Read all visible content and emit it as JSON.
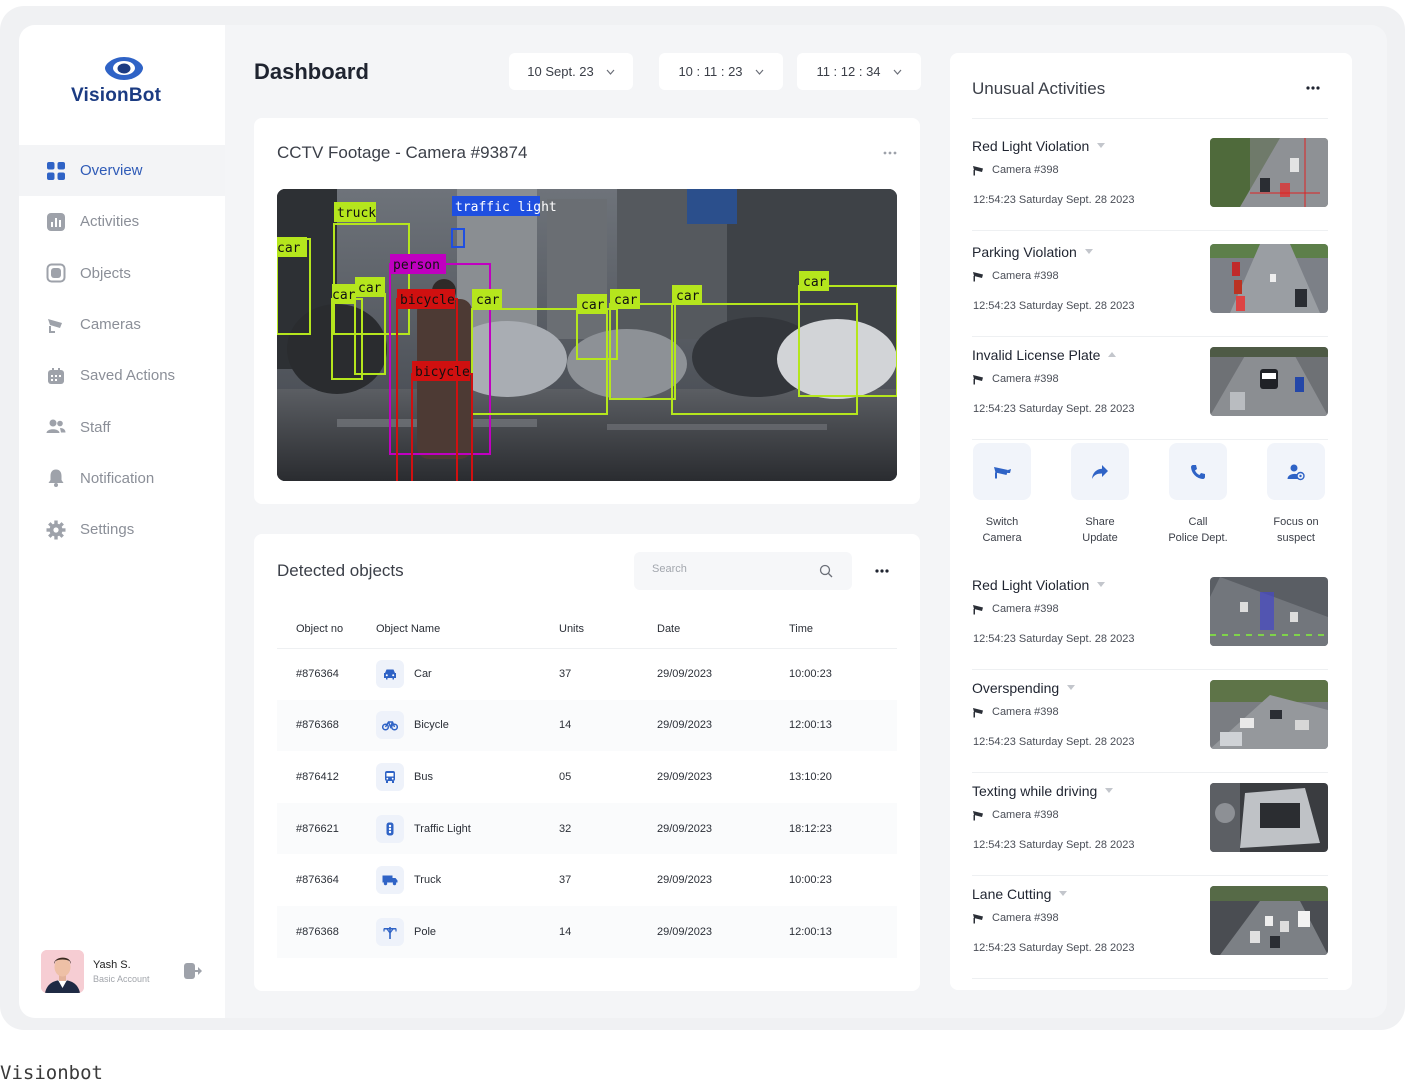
{
  "brand": {
    "name": "VisionBot",
    "color": "#1b3b82"
  },
  "sidebar": {
    "items": [
      {
        "label": "Overview",
        "icon": "grid-icon",
        "active": true
      },
      {
        "label": "Activities",
        "icon": "chart-icon"
      },
      {
        "label": "Objects",
        "icon": "objects-icon"
      },
      {
        "label": "Cameras",
        "icon": "camera-icon"
      },
      {
        "label": "Saved Actions",
        "icon": "calendar-icon"
      },
      {
        "label": "Staff",
        "icon": "users-icon"
      },
      {
        "label": "Notification",
        "icon": "bell-icon"
      },
      {
        "label": "Settings",
        "icon": "gear-icon"
      }
    ],
    "user": {
      "name": "Yash S.",
      "role": "Basic Account"
    }
  },
  "header": {
    "title": "Dashboard",
    "date": "10 Sept. 23",
    "time_from": "10 : 11 : 23",
    "time_to": "11 : 12 : 34"
  },
  "cctv": {
    "title": "CCTV Footage - Camera #93874",
    "detections": [
      "truck",
      "traffic light",
      "car",
      "person",
      "car",
      "car",
      "bicycle",
      "car",
      "car",
      "car",
      "car",
      "car",
      "bicycle"
    ]
  },
  "detected": {
    "title": "Detected objects",
    "search_placeholder": "Search",
    "columns": [
      "Object no",
      "Object Name",
      "Units",
      "Date",
      "Time"
    ],
    "rows": [
      {
        "no": "#876364",
        "name": "Car",
        "icon": "car-icon",
        "units": "37",
        "date": "29/09/2023",
        "time": "10:00:23"
      },
      {
        "no": "#876368",
        "name": "Bicycle",
        "icon": "bicycle-icon",
        "units": "14",
        "date": "29/09/2023",
        "time": "12:00:13"
      },
      {
        "no": "#876412",
        "name": "Bus",
        "icon": "bus-icon",
        "units": "05",
        "date": "29/09/2023",
        "time": "13:10:20"
      },
      {
        "no": "#876621",
        "name": "Traffic Light",
        "icon": "traffic-light-icon",
        "units": "32",
        "date": "29/09/2023",
        "time": "18:12:23"
      },
      {
        "no": "#876364",
        "name": "Truck",
        "icon": "truck-icon",
        "units": "37",
        "date": "29/09/2023",
        "time": "10:00:23"
      },
      {
        "no": "#876368",
        "name": "Pole",
        "icon": "pole-icon",
        "units": "14",
        "date": "29/09/2023",
        "time": "12:00:13"
      }
    ]
  },
  "unusual": {
    "title": "Unusual Activities",
    "items": [
      {
        "title": "Red Light Violation",
        "camera": "Camera #398",
        "time": "12:54:23 Saturday Sept. 28 2023",
        "expanded": false
      },
      {
        "title": "Parking Violation",
        "camera": "Camera #398",
        "time": "12:54:23 Saturday Sept. 28 2023",
        "expanded": false
      },
      {
        "title": "Invalid License Plate",
        "camera": "Camera #398",
        "time": "12:54:23 Saturday Sept. 28 2023",
        "expanded": true
      },
      {
        "title": "Red Light Violation",
        "camera": "Camera #398",
        "time": "12:54:23 Saturday Sept. 28 2023",
        "expanded": false
      },
      {
        "title": "Overspending",
        "camera": "Camera #398",
        "time": "12:54:23 Saturday Sept. 28 2023",
        "expanded": false
      },
      {
        "title": "Texting while driving",
        "camera": "Camera #398",
        "time": "12:54:23 Saturday Sept. 28 2023",
        "expanded": false
      },
      {
        "title": "Lane Cutting",
        "camera": "Camera #398",
        "time": "12:54:23 Saturday Sept. 28 2023",
        "expanded": false
      }
    ],
    "actions": [
      {
        "line1": "Switch",
        "line2": "Camera",
        "icon": "cctv-icon"
      },
      {
        "line1": "Share",
        "line2": "Update",
        "icon": "share-icon"
      },
      {
        "line1": "Call",
        "line2": "Police Dept.",
        "icon": "phone-icon"
      },
      {
        "line1": "Focus on",
        "line2": "suspect",
        "icon": "focus-user-icon"
      }
    ]
  },
  "caption": "Visionbot",
  "colors": {
    "accent": "#2f5bb7",
    "background": "#f4f5f7",
    "card": "#ffffff",
    "muted": "#8b8f98"
  }
}
